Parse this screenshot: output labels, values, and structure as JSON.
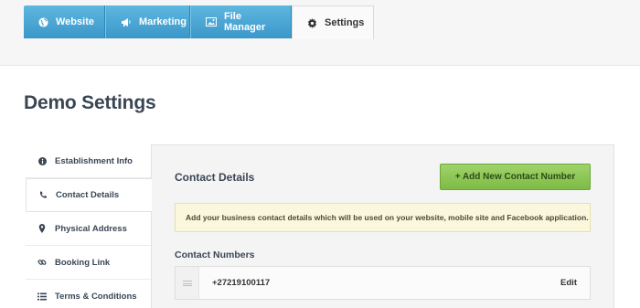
{
  "tabs": [
    {
      "label": "Website",
      "icon": "globe-icon"
    },
    {
      "label": "Marketing",
      "icon": "megaphone-icon"
    },
    {
      "label": "File Manager",
      "icon": "image-icon"
    },
    {
      "label": "Settings",
      "icon": "gear-icon"
    }
  ],
  "page": {
    "title": "Demo Settings"
  },
  "sidebar": {
    "items": [
      {
        "label": "Establishment Info",
        "icon": "info-icon"
      },
      {
        "label": "Contact Details",
        "icon": "phone-icon"
      },
      {
        "label": "Physical Address",
        "icon": "map-pin-icon"
      },
      {
        "label": "Booking Link",
        "icon": "link-icon"
      },
      {
        "label": "Terms & Conditions",
        "icon": "list-icon"
      }
    ]
  },
  "main": {
    "section_title": "Contact Details",
    "add_button": "+ Add New Contact Number",
    "notice": "Add your business contact details which will be used on your website, mobile site and Facebook application.",
    "contact_numbers_title": "Contact Numbers",
    "contacts": [
      {
        "number": "+27219100117",
        "edit_label": "Edit"
      }
    ]
  },
  "colors": {
    "tab_blue": "#3a97c9",
    "add_button_green": "#7dbb45",
    "notice_bg": "#fbf7dc",
    "title_text": "#3a4654"
  }
}
